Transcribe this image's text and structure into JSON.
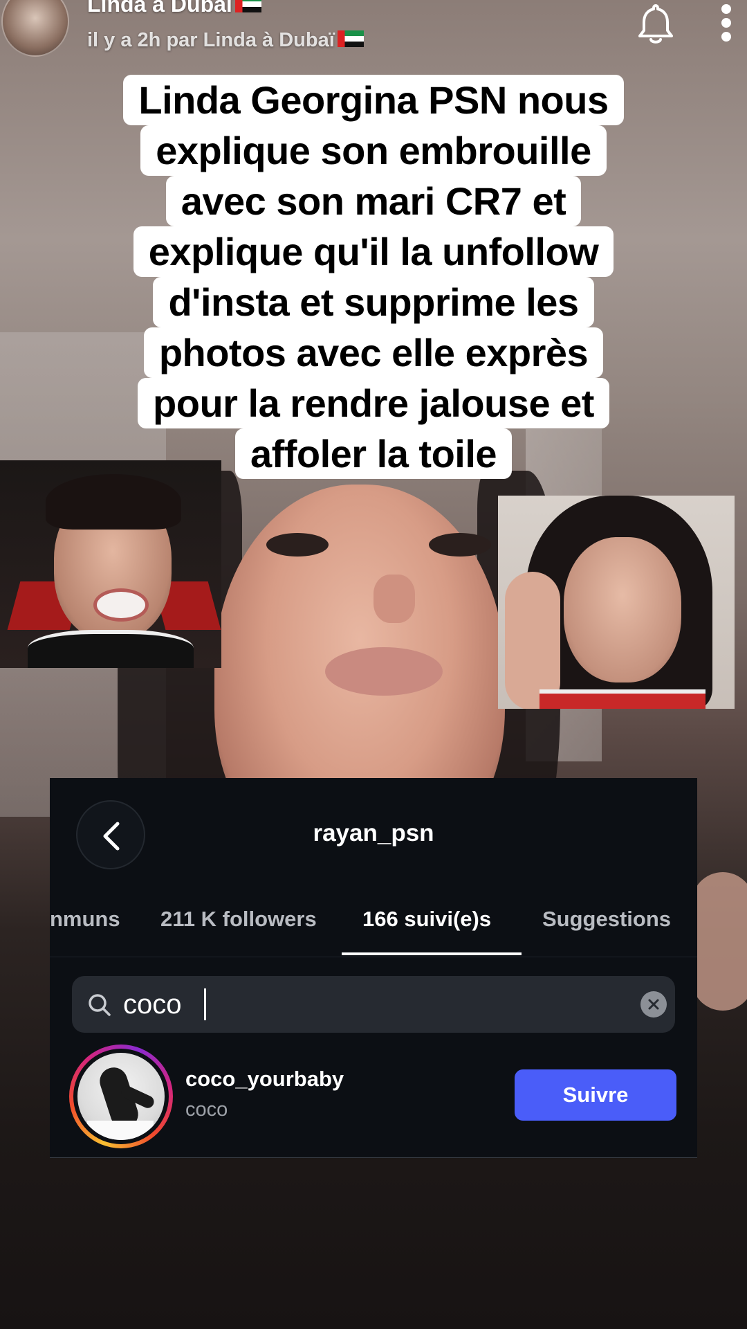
{
  "header": {
    "author": "Linda à Dubaï",
    "subline": "il y a 2h par Linda à Dubaï",
    "icons": [
      "avatar",
      "uae-flag-icon",
      "bell-icon",
      "more-options-icon"
    ]
  },
  "caption": {
    "lines": [
      "Linda Georgina PSN nous",
      "explique son embrouille",
      "avec son mari CR7 et",
      "explique qu'il la unfollow",
      "d'insta et supprime les",
      "photos avec elle exprès",
      "pour la rendre jalouse et",
      "affoler la toile"
    ]
  },
  "instagram": {
    "profile": "rayan_psn",
    "tabs": [
      "nmuns",
      "211 K followers",
      "166 suivi(e)s",
      "Suggestions"
    ],
    "active_tab": "166 suivi(e)s",
    "search_value": "coco",
    "result": {
      "username": "coco_yourbaby",
      "fullname": "coco",
      "button": "Suivre"
    },
    "colors": {
      "background": "#0c0f14",
      "follow_button": "#4a5df9"
    }
  }
}
